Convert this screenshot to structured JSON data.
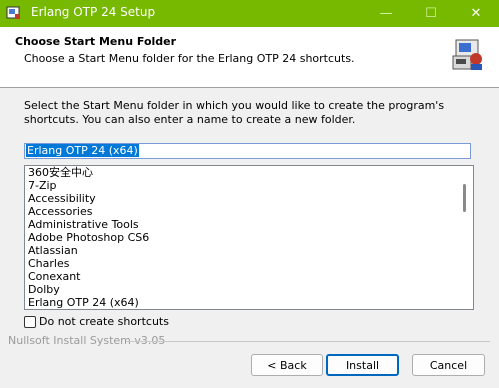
{
  "window": {
    "title": "Erlang OTP 24 Setup",
    "title_bar_color": "#76b900"
  },
  "controls": {
    "minimize": "—",
    "maximize": "☐",
    "close": "✕"
  },
  "header": {
    "title": "Choose Start Menu Folder",
    "subtitle": "Choose a Start Menu folder for the Erlang OTP 24 shortcuts.",
    "icon": "installer-icon"
  },
  "instructions": "Select the Start Menu folder in which you would like to create the program's shortcuts. You can also enter a name to create a new folder.",
  "folder_input": {
    "value": "Erlang OTP 24 (x64)"
  },
  "folder_list": {
    "items": [
      "360安全中心",
      "7-Zip",
      "Accessibility",
      "Accessories",
      "Administrative Tools",
      "Adobe Photoshop CS6",
      "Atlassian",
      "Charles",
      "Conexant",
      "Dolby",
      "Erlang OTP 24 (x64)"
    ]
  },
  "checkbox": {
    "label": "Do not create shortcuts",
    "checked": false
  },
  "branding": "Nullsoft Install System v3.05",
  "buttons": {
    "back": "< Back",
    "install": "Install",
    "cancel": "Cancel"
  }
}
